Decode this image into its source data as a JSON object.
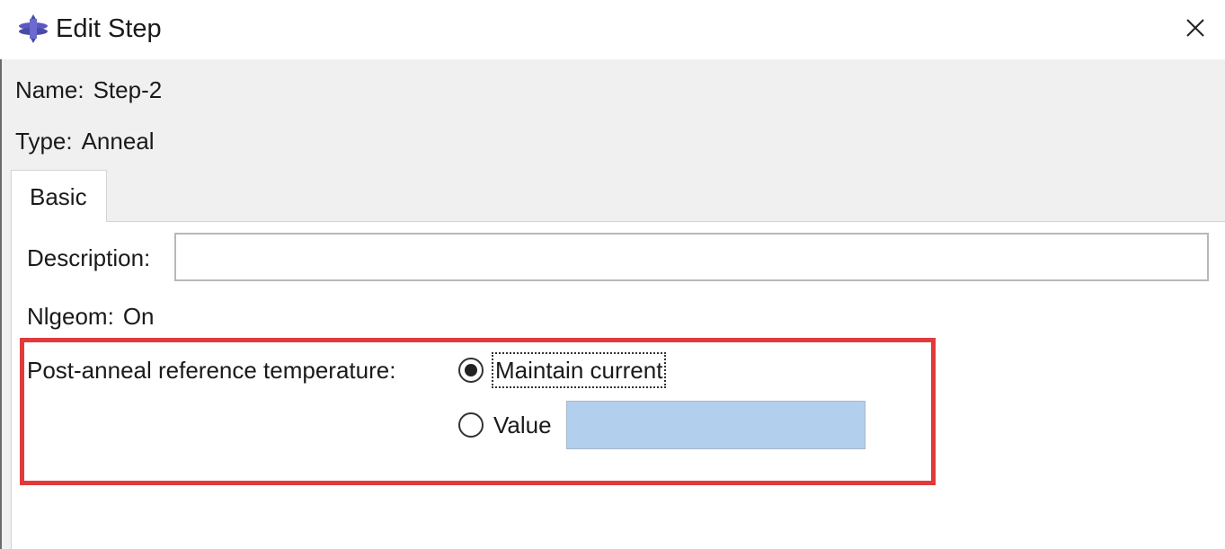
{
  "window": {
    "title": "Edit Step",
    "icon": "abaqus-app-icon",
    "close_icon": "close-icon"
  },
  "info": {
    "name_label": "Name:",
    "name_value": "Step-2",
    "type_label": "Type:",
    "type_value": "Anneal"
  },
  "tabs": [
    {
      "label": "Basic",
      "selected": true
    }
  ],
  "basic": {
    "description": {
      "label": "Description:",
      "value": "",
      "placeholder": ""
    },
    "nlgeom": {
      "label": "Nlgeom:",
      "value": "On"
    },
    "post_anneal": {
      "label": "Post-anneal reference temperature:",
      "options": [
        {
          "label": "Maintain current",
          "selected": true
        },
        {
          "label": "Value",
          "selected": false
        }
      ],
      "value_field": ""
    }
  },
  "colors": {
    "highlight_border": "#e23a3a",
    "value_field_bg": "#b3cfee"
  }
}
